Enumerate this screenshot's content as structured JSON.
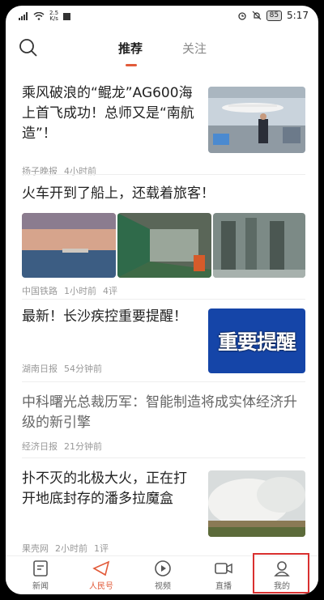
{
  "status_bar": {
    "net_speed_top": "2.5",
    "net_speed_bottom": "K/s",
    "battery": "85",
    "time": "5:17"
  },
  "header": {
    "tabs": [
      {
        "label": "推荐",
        "active": true
      },
      {
        "label": "关注",
        "active": false
      }
    ]
  },
  "feed": {
    "items": [
      {
        "title": "乘风破浪的“鲲龙”AG600海上首飞成功！总师又是“南航造”！",
        "source": "扬子晚报",
        "time": "4小时前",
        "comments": ""
      },
      {
        "title": "火车开到了船上，还载着旅客！",
        "source": "中国铁路",
        "time": "1小时前",
        "comments": "4评"
      },
      {
        "title": "最新！长沙疾控重要提醒！",
        "source": "湖南日报",
        "time": "54分钟前",
        "comments": "",
        "thumb_text": "重要提醒"
      },
      {
        "title": "中科曙光总裁历军：智能制造将成实体经济升级的新引擎",
        "source": "经济日报",
        "time": "21分钟前",
        "comments": ""
      },
      {
        "title": "扑不灭的北极大火，正在打开地底封存的潘多拉魔盒",
        "source": "果壳网",
        "time": "2小时前",
        "comments": "1评"
      }
    ]
  },
  "bottom_nav": {
    "items": [
      {
        "label": "新闻",
        "icon": "news-icon"
      },
      {
        "label": "人民号",
        "icon": "paper-plane-icon"
      },
      {
        "label": "视频",
        "icon": "video-play-icon"
      },
      {
        "label": "直播",
        "icon": "camera-icon"
      },
      {
        "label": "我的",
        "icon": "user-icon"
      }
    ]
  },
  "colors": {
    "accent": "#e25b3a",
    "highlight": "#d9302f"
  }
}
